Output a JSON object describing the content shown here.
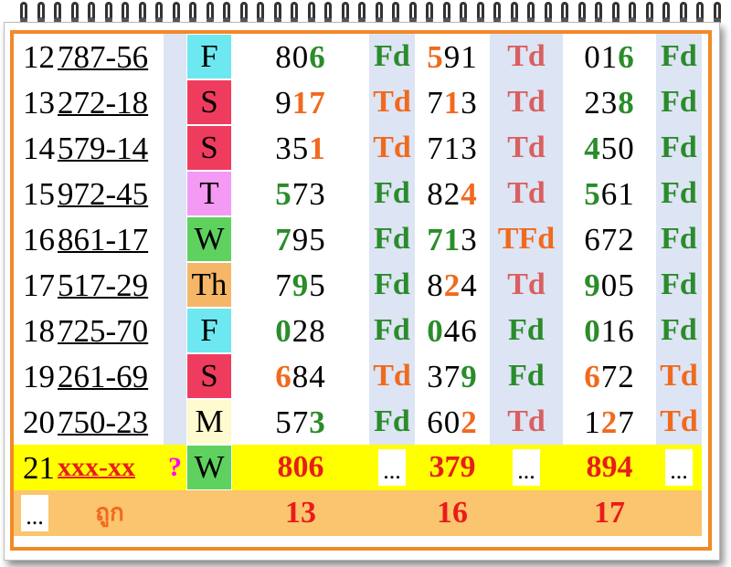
{
  "colors": {
    "frame": "#f08a28",
    "green": "#2a8c2a",
    "orange": "#f06a1e",
    "pink_status": "#d86060",
    "highlight_yellow": "#ffff00",
    "footer_orange": "#fbc46e",
    "day_F": "#6ee8f0",
    "day_S": "#ef3c5e",
    "day_T": "#f49af4",
    "day_W": "#5fd15f",
    "day_Th": "#f6b667",
    "day_M": "#fffad0"
  },
  "rows": [
    {
      "no": "12",
      "serial": "787-56",
      "day": "F",
      "day_color": "#6ee8f0",
      "p1": [
        "8",
        "0",
        "6"
      ],
      "p1c": [
        "k",
        "k",
        "g"
      ],
      "s1": "Fd",
      "s1c": "stg",
      "p2": [
        "5",
        "9",
        "1"
      ],
      "p2c": [
        "o",
        "k",
        "k"
      ],
      "s2": "Td",
      "s2c": "stp",
      "p3": [
        "0",
        "1",
        "6"
      ],
      "p3c": [
        "k",
        "k",
        "g"
      ],
      "s3": "Fd",
      "s3c": "stg"
    },
    {
      "no": "13",
      "serial": "272-18",
      "day": "S",
      "day_color": "#ef3c5e",
      "p1": [
        "9",
        "1",
        "7"
      ],
      "p1c": [
        "k",
        "o",
        "o"
      ],
      "s1": "Td",
      "s1c": "sto",
      "p2": [
        "7",
        "1",
        "3"
      ],
      "p2c": [
        "k",
        "o",
        "k"
      ],
      "s2": "Td",
      "s2c": "stp",
      "p3": [
        "2",
        "3",
        "8"
      ],
      "p3c": [
        "k",
        "k",
        "g"
      ],
      "s3": "Fd",
      "s3c": "stg"
    },
    {
      "no": "14",
      "serial": "579-14",
      "day": "S",
      "day_color": "#ef3c5e",
      "p1": [
        "3",
        "5",
        "1"
      ],
      "p1c": [
        "k",
        "k",
        "o"
      ],
      "s1": "Td",
      "s1c": "sto",
      "p2": [
        "7",
        "1",
        "3"
      ],
      "p2c": [
        "k",
        "k",
        "k"
      ],
      "s2": "Td",
      "s2c": "stp",
      "p3": [
        "4",
        "5",
        "0"
      ],
      "p3c": [
        "g",
        "k",
        "k"
      ],
      "s3": "Fd",
      "s3c": "stg"
    },
    {
      "no": "15",
      "serial": "972-45",
      "day": "T",
      "day_color": "#f49af4",
      "p1": [
        "5",
        "7",
        "3"
      ],
      "p1c": [
        "g",
        "k",
        "k"
      ],
      "s1": "Fd",
      "s1c": "stg",
      "p2": [
        "8",
        "2",
        "4"
      ],
      "p2c": [
        "k",
        "k",
        "o"
      ],
      "s2": "Td",
      "s2c": "stp",
      "p3": [
        "5",
        "6",
        "1"
      ],
      "p3c": [
        "g",
        "k",
        "k"
      ],
      "s3": "Fd",
      "s3c": "stg"
    },
    {
      "no": "16",
      "serial": "861-17",
      "day": "W",
      "day_color": "#5fd15f",
      "p1": [
        "7",
        "9",
        "5"
      ],
      "p1c": [
        "g",
        "k",
        "k"
      ],
      "s1": "Fd",
      "s1c": "stg",
      "p2": [
        "7",
        "1",
        "3"
      ],
      "p2c": [
        "g",
        "g",
        "k"
      ],
      "s2": "TFd",
      "s2c": "sto",
      "p3": [
        "6",
        "7",
        "2"
      ],
      "p3c": [
        "k",
        "k",
        "k"
      ],
      "s3": "Fd",
      "s3c": "stg"
    },
    {
      "no": "17",
      "serial": "517-29",
      "day": "Th",
      "day_color": "#f6b667",
      "p1": [
        "7",
        "9",
        "5"
      ],
      "p1c": [
        "k",
        "g",
        "k"
      ],
      "s1": "Fd",
      "s1c": "stg",
      "p2": [
        "8",
        "2",
        "4"
      ],
      "p2c": [
        "k",
        "o",
        "k"
      ],
      "s2": "Td",
      "s2c": "stp",
      "p3": [
        "9",
        "0",
        "5"
      ],
      "p3c": [
        "g",
        "k",
        "k"
      ],
      "s3": "Fd",
      "s3c": "stg"
    },
    {
      "no": "18",
      "serial": "725-70",
      "day": "F",
      "day_color": "#6ee8f0",
      "p1": [
        "0",
        "2",
        "8"
      ],
      "p1c": [
        "g",
        "k",
        "k"
      ],
      "s1": "Fd",
      "s1c": "stg",
      "p2": [
        "0",
        "4",
        "6"
      ],
      "p2c": [
        "g",
        "k",
        "k"
      ],
      "s2": "Fd",
      "s2c": "stg",
      "p3": [
        "0",
        "1",
        "6"
      ],
      "p3c": [
        "g",
        "k",
        "k"
      ],
      "s3": "Fd",
      "s3c": "stg"
    },
    {
      "no": "19",
      "serial": "261-69",
      "day": "S",
      "day_color": "#ef3c5e",
      "p1": [
        "6",
        "8",
        "4"
      ],
      "p1c": [
        "o",
        "k",
        "k"
      ],
      "s1": "Td",
      "s1c": "sto",
      "p2": [
        "3",
        "7",
        "9"
      ],
      "p2c": [
        "k",
        "k",
        "g"
      ],
      "s2": "Fd",
      "s2c": "stg",
      "p3": [
        "6",
        "7",
        "2"
      ],
      "p3c": [
        "o",
        "k",
        "k"
      ],
      "s3": "Td",
      "s3c": "sto"
    },
    {
      "no": "20",
      "serial": "750-23",
      "day": "M",
      "day_color": "#fffad0",
      "p1": [
        "5",
        "7",
        "3"
      ],
      "p1c": [
        "k",
        "k",
        "g"
      ],
      "s1": "Fd",
      "s1c": "stg",
      "p2": [
        "6",
        "0",
        "2"
      ],
      "p2c": [
        "k",
        "k",
        "o"
      ],
      "s2": "Td",
      "s2c": "stp",
      "p3": [
        "1",
        "2",
        "7"
      ],
      "p3c": [
        "k",
        "o",
        "k"
      ],
      "s3": "Td",
      "s3c": "sto"
    }
  ],
  "current": {
    "no": "21",
    "serial": "xxx-xx",
    "question": "?",
    "day": "W",
    "day_color": "#5fd15f",
    "p1": "806",
    "p2": "379",
    "p3": "894",
    "placeholder": "..."
  },
  "footer": {
    "dots": "...",
    "label": "ถูก",
    "hit1": "13",
    "hit2": "16",
    "hit3": "17"
  }
}
